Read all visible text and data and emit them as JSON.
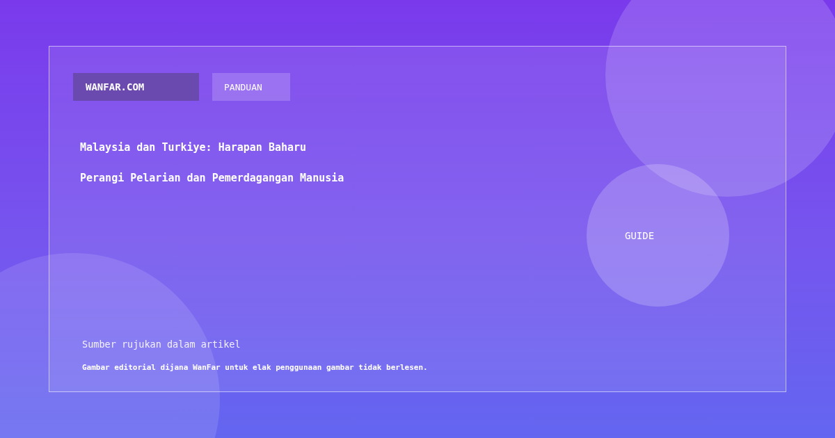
{
  "brand": "WANFAR.COM",
  "badge": "PANDUAN",
  "headlines": [
    "Malaysia dan Turkiye: Harapan Baharu",
    "Perangi Pelarian dan Pemerdagangan Manusia"
  ],
  "circle_label": "GUIDE",
  "source_note": "Sumber rujukan dalam artikel",
  "disclaimer": "Gambar editorial dijana WanFar untuk elak penggunaan gambar tidak berlesen."
}
